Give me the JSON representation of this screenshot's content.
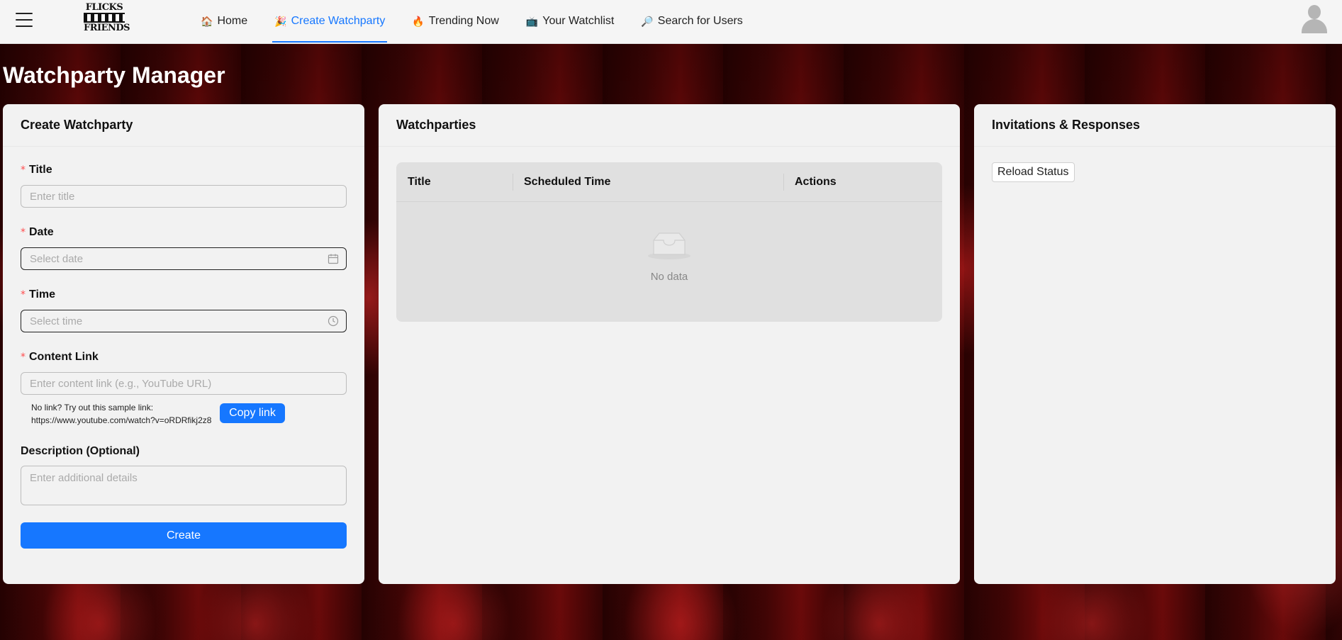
{
  "nav": {
    "logo_top": "FLICKS",
    "logo_bottom": "FRIENDS",
    "items": [
      {
        "icon": "🏠",
        "label": "Home",
        "active": false
      },
      {
        "icon": "🎉",
        "label": "Create Watchparty",
        "active": true
      },
      {
        "icon": "🔥",
        "label": "Trending Now",
        "active": false
      },
      {
        "icon": "📺",
        "label": "Your Watchlist",
        "active": false
      },
      {
        "icon": "🔎",
        "label": "Search for Users",
        "active": false
      }
    ],
    "accent_color": "#1677ff"
  },
  "page_title": "Watchparty Manager",
  "create_card": {
    "title": "Create Watchparty",
    "title_label": "Title",
    "title_placeholder": "Enter title",
    "date_label": "Date",
    "date_placeholder": "Select date",
    "time_label": "Time",
    "time_placeholder": "Select time",
    "link_label": "Content Link",
    "link_placeholder": "Enter content link (e.g., YouTube URL)",
    "hint_line1": "No link? Try out this sample link:",
    "hint_line2": "https://www.youtube.com/watch?v=oRDRfikj2z8",
    "copy_button": "Copy link",
    "description_label": "Description (Optional)",
    "description_placeholder": "Enter additional details",
    "create_button": "Create",
    "required_mark": "*"
  },
  "parties_card": {
    "title": "Watchparties",
    "columns": [
      "Title",
      "Scheduled Time",
      "Actions"
    ],
    "empty_text": "No data"
  },
  "invites_card": {
    "title": "Invitations & Responses",
    "reload_button": "Reload Status"
  }
}
